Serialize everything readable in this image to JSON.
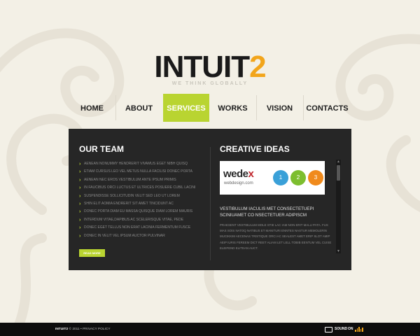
{
  "logo": {
    "main": "INTUIT",
    "accent": "2",
    "tagline": "WE THINK GLOBALLY"
  },
  "nav": [
    "HOME",
    "ABOUT",
    "SERVICES",
    "WORKS",
    "VISION",
    "CONTACTS"
  ],
  "nav_active": "SERVICES",
  "team": {
    "title": "OUR TEAM",
    "items": [
      "AENEAN NONUMMY HENDRERIT VIVAMUS EGET NIBH QUISQ",
      "ETIAM CURSUS LEO VEL METUS NULLA FACILISI DONEC PORTA",
      "AENEAN NEC EROS VESTIBULUM ANTE IPSUM PRIMIS",
      "IN FAUCIBUS ORCI LUCTUS ET ULTRICES POSUERE CUBIL LACINI",
      "SUSPENDISSE SOLLICITUDIN VELIT SED LEO UT  LOREM",
      "SHIN ELIT AOMIA ENDRERIT SIT AMET TINCIDUNT AC",
      "DONEC PORTA DIAM EU MASSA QUISQUE DIAM LOREM MAURIS",
      "INTERDUM VITAE,DAPIBUS AC SCELERISQUE VITAE, PEDE",
      "DONEC EGET TELLUS NON ERAT LACINIA FERMENTUM FUSCE",
      "DONEC IN VELIT VEL IPSUM AUCTOR PULVINAR"
    ],
    "button": "READ MORE"
  },
  "creative": {
    "title": "CREATIVE IDEAS",
    "image_logo": "wedex",
    "image_sub": "webdesign.com",
    "circles": [
      "1",
      "2",
      "3"
    ],
    "heading": "VESTIBULUM IACULIS MET CONSECTETUEPI SCINIUAMET CO NSECTETUER ADIPISCM",
    "body": "PRAESENT VESTIBULUM MOLE STIE LAC IAM NON ERIT MALU PATA. FUS MAS SOIS NATOQ NATIBUS ET MANITURI ENNTES NASTUR MEMOLERIN MUCIKKIM AECENAS TRISTIQUE ORCI AC SEALEST AMET ERIP SLOT AMIP AEIP IURIS FEREEM DICT REET ALIAM LET LELL TOBIB EENTUM VEL CUISE ELEIFEND ELITEAN AUCT."
  },
  "footer": {
    "brand": "INTUIT2",
    "copy": " © 2011 • PRIVACY POLICY",
    "sound_label": "SOUND",
    "sound_state": "ON"
  },
  "colors": {
    "accent_green": "#b9d431",
    "accent_orange": "#f2a51b",
    "panel": "#262626",
    "background": "#f3f0e6"
  }
}
